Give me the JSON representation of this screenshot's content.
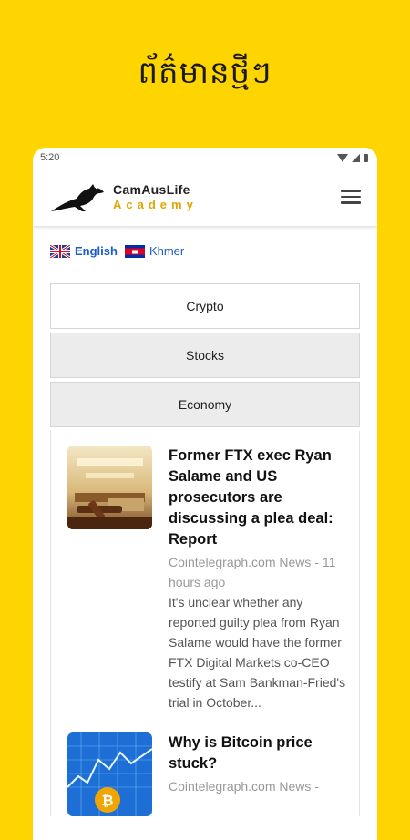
{
  "promo": {
    "title": "ព័ត៌មានថ្មីៗ"
  },
  "status": {
    "time": "5:20"
  },
  "app": {
    "name": "CamAusLife",
    "subtitle": "Academy"
  },
  "languages": [
    {
      "label": "English",
      "flag": "uk-flag-icon"
    },
    {
      "label": "Khmer",
      "flag": "cambodia-flag-icon"
    }
  ],
  "tabs": [
    {
      "label": "Crypto",
      "active": true
    },
    {
      "label": "Stocks",
      "active": false
    },
    {
      "label": "Economy",
      "active": false
    }
  ],
  "news": [
    {
      "title": "Former FTX exec Ryan Salame and US prosecutors are discussing a plea deal: Report",
      "source": "Cointelegraph.com News - 11 hours ago",
      "description": "It's unclear whether any reported guilty plea from Ryan Salame would have the former FTX Digital Markets co-CEO testify at Sam Bankman-Fried's trial in October...",
      "image": "courtroom-gavel-image"
    },
    {
      "title": "Why is Bitcoin price stuck?",
      "source": "Cointelegraph.com News -",
      "description": "",
      "image": "bitcoin-chart-image"
    }
  ],
  "colors": {
    "background": "#FFD500",
    "link": "#1a5cc8",
    "accent": "#e0a500"
  }
}
